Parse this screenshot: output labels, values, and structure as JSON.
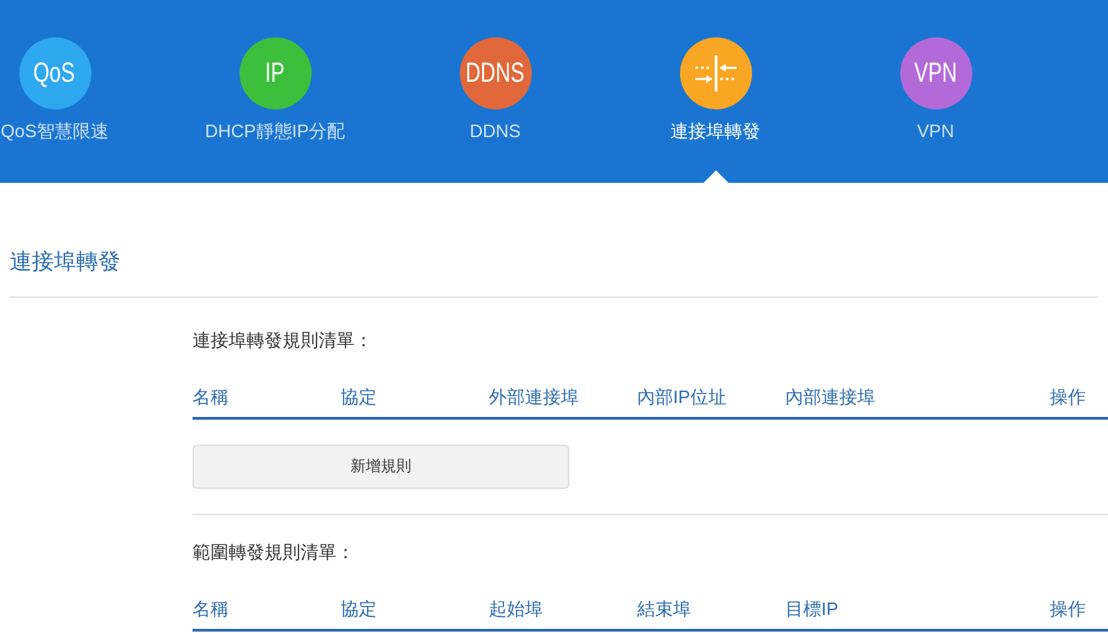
{
  "nav": [
    {
      "kind": "text",
      "badge": "QoS",
      "label": "QoS智慧限速",
      "color": "#2ea8ee",
      "selected": false
    },
    {
      "kind": "text",
      "badge": "IP",
      "label": "DHCP靜態IP分配",
      "color": "#3cbf3c",
      "selected": false
    },
    {
      "kind": "text",
      "badge": "DDNS",
      "label": "DDNS",
      "color": "#e0683a",
      "selected": false
    },
    {
      "kind": "ports",
      "label": "連接埠轉發",
      "color": "#f8a623",
      "selected": true
    },
    {
      "kind": "text",
      "badge": "VPN",
      "label": "VPN",
      "color": "#b36ad8",
      "selected": false
    }
  ],
  "page_title": "連接埠轉發",
  "sections": [
    {
      "heading": "連接埠轉發規則清單：",
      "columns": [
        "名稱",
        "協定",
        "外部連接埠",
        "內部IP位址",
        "內部連接埠",
        "操作"
      ],
      "button": "新增規則"
    },
    {
      "heading": "範圍轉發規則清單：",
      "columns": [
        "名稱",
        "協定",
        "起始埠",
        "結束埠",
        "目標IP",
        "操作"
      ]
    }
  ]
}
